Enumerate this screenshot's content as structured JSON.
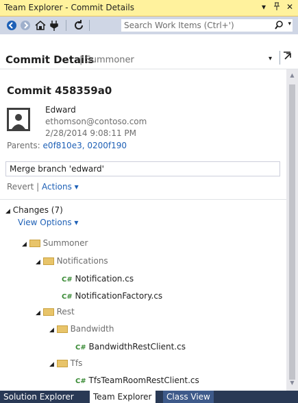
{
  "window": {
    "title": "Team Explorer - Commit Details",
    "pin_glyph": "ᵖ",
    "buttons": {
      "dropdown": "▾",
      "pin": "ᵖ",
      "close": "✕"
    }
  },
  "toolbar": {
    "search_placeholder": "Search Work Items (Ctrl+')",
    "search_icon": "⌕",
    "search_dropdown": "▾"
  },
  "header": {
    "title": "Commit Details",
    "separator": "|",
    "subtitle": "Summoner",
    "dropdown": "▾",
    "dock": "↗"
  },
  "commit": {
    "heading": "Commit 458359a0",
    "author": "Edward",
    "email": "ethomson@contoso.com",
    "date": "2/28/2014 9:08:11 PM",
    "parents_label": "Parents:",
    "parents_value": "e0f810e3, 0200f190",
    "message": "Merge branch 'edward'",
    "revert": "Revert",
    "sep": "|",
    "actions": "Actions ▾"
  },
  "changes": {
    "label": "Changes (7)",
    "view_options": "View Options ▾",
    "tree": [
      {
        "type": "folder",
        "name": "Summoner",
        "depth": 0
      },
      {
        "type": "folder",
        "name": "Notifications",
        "depth": 1
      },
      {
        "type": "file",
        "name": "Notification.cs",
        "depth": 2
      },
      {
        "type": "file",
        "name": "NotificationFactory.cs",
        "depth": 2
      },
      {
        "type": "folder",
        "name": "Rest",
        "depth": 1
      },
      {
        "type": "folder",
        "name": "Bandwidth",
        "depth": 2
      },
      {
        "type": "file",
        "name": "BandwidthRestClient.cs",
        "depth": 3
      },
      {
        "type": "folder",
        "name": "Tfs",
        "depth": 2
      },
      {
        "type": "file",
        "name": "TfsTeamRoomRestClient.cs",
        "depth": 3
      }
    ],
    "cs_glyph": "C#",
    "expand_glyph": "◢"
  },
  "tabs": [
    "Solution Explorer",
    "Team Explorer",
    "Class View"
  ],
  "colors": {
    "title_bar": "#fff29d",
    "toolbar": "#cfd6e5",
    "link": "#1e60b6",
    "tab_bar": "#293955",
    "cs_green": "#388a34",
    "folder": "#e8c46a"
  },
  "icons": [
    "back-icon",
    "forward-icon",
    "home-icon",
    "connect-icon",
    "refresh-icon",
    "search-icon",
    "user-avatar-icon",
    "folder-icon",
    "csharp-file-icon"
  ]
}
